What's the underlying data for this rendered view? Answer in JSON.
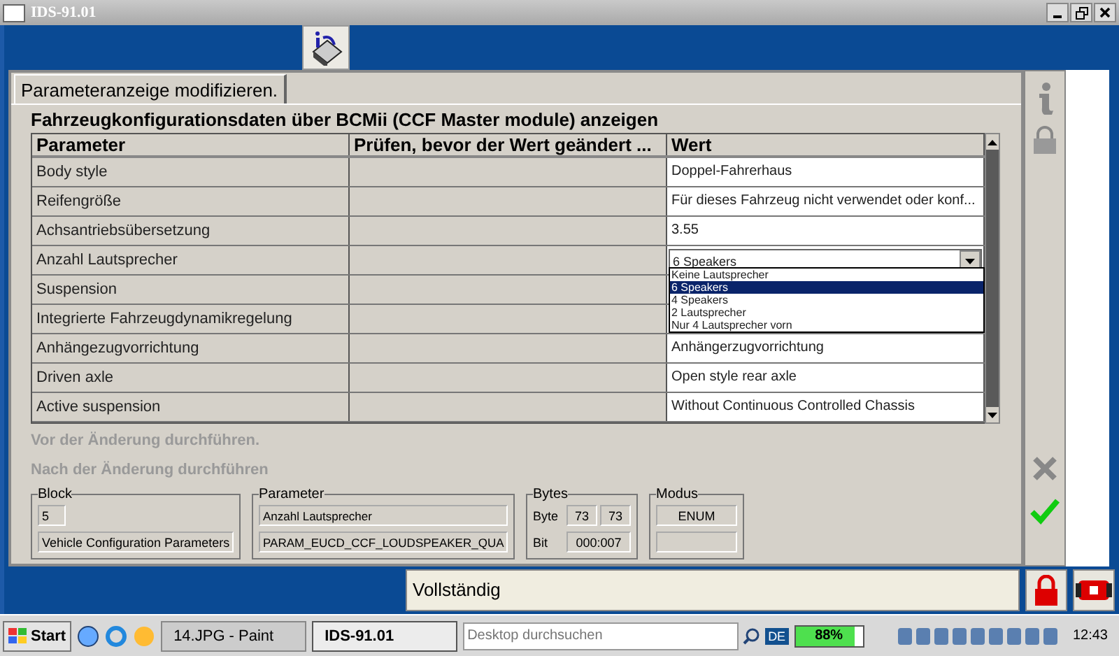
{
  "window": {
    "title": "IDS-91.01"
  },
  "tab": {
    "label": "Parameteranzeige modifizieren."
  },
  "heading": "Fahrzeugkonfigurationsdaten über BCMii (CCF Master module) anzeigen",
  "table": {
    "columns": [
      "Parameter",
      "Prüfen, bevor der Wert geändert ...",
      "Wert"
    ],
    "rows": [
      {
        "kind": "text",
        "parameter": "Body style",
        "value": "Doppel-Fahrerhaus"
      },
      {
        "kind": "text",
        "parameter": "Reifengröße",
        "value": "Für dieses Fahrzeug nicht verwendet oder konf..."
      },
      {
        "kind": "text",
        "parameter": "Achsantriebsübersetzung",
        "value": "3.55"
      },
      {
        "kind": "dropdown",
        "parameter": "Anzahl Lautsprecher",
        "value": "6 Speakers",
        "expanded": true,
        "options": [
          {
            "label": "Keine Lautsprecher",
            "selected": false
          },
          {
            "label": "6 Speakers",
            "selected": true
          },
          {
            "label": "4 Speakers",
            "selected": false
          },
          {
            "label": "2 Lautsprecher",
            "selected": false
          },
          {
            "label": "Nur 4 Lautsprecher vorn",
            "selected": false
          }
        ]
      },
      {
        "kind": "text",
        "parameter": "Suspension"
      },
      {
        "kind": "text",
        "parameter": "Integrierte Fahrzeugdynamikregelung"
      },
      {
        "kind": "text",
        "parameter": "Anhängezugvorrichtung",
        "value": "Anhängerzugvorrichtung"
      },
      {
        "kind": "text",
        "parameter": "Driven axle",
        "value": "Open style rear axle"
      },
      {
        "kind": "text",
        "parameter": "Active suspension",
        "value": "Without Continuous Controlled Chassis"
      }
    ]
  },
  "steps": [
    {
      "label": "Vor der Änderung durchführen.",
      "disabled": true
    },
    {
      "label": "Nach der Änderung durchführen",
      "disabled": true
    }
  ],
  "block": {
    "title": "Block",
    "number": "5",
    "name": "Vehicle Configuration Parameters"
  },
  "parameter": {
    "title": "Parameter",
    "name": "Anzahl Lautsprecher",
    "code": "PARAM_EUCD_CCF_LOUDSPEAKER_QUA"
  },
  "bytes": {
    "title": "Bytes",
    "byte_label": "Byte",
    "byte_from": "73",
    "byte_to": "73",
    "bit_label": "Bit",
    "bit": "000:007"
  },
  "mode": {
    "title": "Modus",
    "value": "ENUM"
  },
  "status": "Vollständig",
  "taskbar": {
    "start": "Start",
    "tasks": [
      {
        "label": "14.JPG - Paint",
        "selected": false
      },
      {
        "label": "IDS-91.01",
        "selected": true
      }
    ],
    "search_placeholder": "Desktop durchsuchen",
    "language": "DE",
    "battery": {
      "level": 0.88,
      "reading": "88%"
    },
    "clock": "12:43"
  }
}
